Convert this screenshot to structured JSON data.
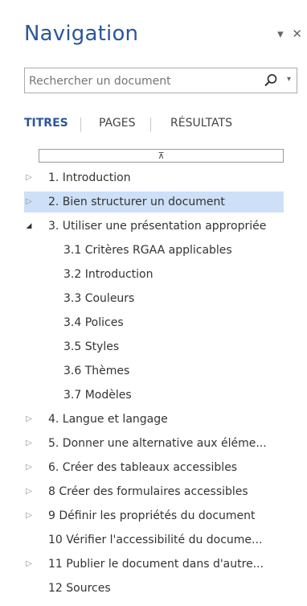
{
  "pane": {
    "title": "Navigation",
    "options_glyph": "▾",
    "close_glyph": "✕"
  },
  "search": {
    "placeholder": "Rechercher un document",
    "value": "",
    "icon": "search-icon",
    "dropdown_glyph": "▾"
  },
  "tabs": [
    {
      "label": "TITRES",
      "active": true
    },
    {
      "label": "PAGES",
      "active": false
    },
    {
      "label": "RÉSULTATS",
      "active": false
    }
  ],
  "collapse_glyph": "⊼",
  "headings": [
    {
      "label": "1. Introduction",
      "level": 1,
      "toggle": "collapsed",
      "selected": false
    },
    {
      "label": "2. Bien structurer un document",
      "level": 1,
      "toggle": "collapsed",
      "selected": true
    },
    {
      "label": "3. Utiliser une présentation appropriée",
      "level": 1,
      "toggle": "expanded",
      "selected": false
    },
    {
      "label": "3.1 Critères RGAA applicables",
      "level": 2,
      "toggle": "none",
      "selected": false
    },
    {
      "label": "3.2 Introduction",
      "level": 2,
      "toggle": "none",
      "selected": false
    },
    {
      "label": "3.3 Couleurs",
      "level": 2,
      "toggle": "none",
      "selected": false
    },
    {
      "label": "3.4 Polices",
      "level": 2,
      "toggle": "none",
      "selected": false
    },
    {
      "label": "3.5 Styles",
      "level": 2,
      "toggle": "none",
      "selected": false
    },
    {
      "label": "3.6 Thèmes",
      "level": 2,
      "toggle": "none",
      "selected": false
    },
    {
      "label": "3.7 Modèles",
      "level": 2,
      "toggle": "none",
      "selected": false
    },
    {
      "label": "4. Langue et langage",
      "level": 1,
      "toggle": "collapsed",
      "selected": false
    },
    {
      "label": "5. Donner une alternative aux éléme...",
      "level": 1,
      "toggle": "collapsed",
      "selected": false
    },
    {
      "label": "6. Créer des tableaux accessibles",
      "level": 1,
      "toggle": "collapsed",
      "selected": false
    },
    {
      "label": "8 Créer des formulaires accessibles",
      "level": 1,
      "toggle": "collapsed",
      "selected": false
    },
    {
      "label": "9 Définir les propriétés du document",
      "level": 1,
      "toggle": "collapsed",
      "selected": false
    },
    {
      "label": "10 Vérifier l'accessibilité du docume...",
      "level": 1,
      "toggle": "none",
      "selected": false
    },
    {
      "label": "11 Publier le document dans d'autre...",
      "level": 1,
      "toggle": "collapsed",
      "selected": false
    },
    {
      "label": "12 Sources",
      "level": 1,
      "toggle": "none",
      "selected": false
    }
  ],
  "colors": {
    "accent": "#2b579a",
    "selection": "#cde0f7"
  }
}
